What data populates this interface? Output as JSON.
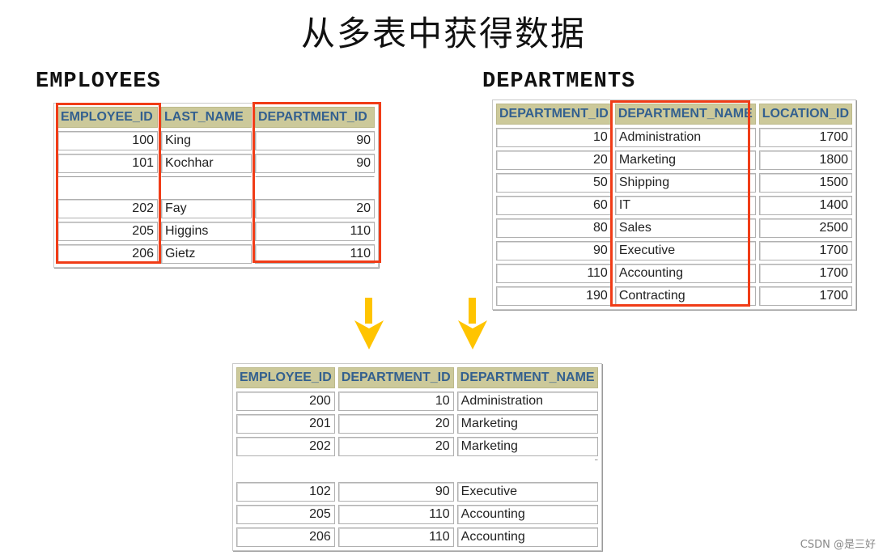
{
  "title": "从多表中获得数据",
  "employees": {
    "label": "EMPLOYEES",
    "columns": [
      "EMPLOYEE_ID",
      "LAST_NAME",
      "DEPARTMENT_ID"
    ],
    "rows": [
      [
        "100",
        "King",
        "90"
      ],
      [
        "101",
        "Kochhar",
        "90"
      ],
      [
        "",
        "",
        ""
      ],
      [
        "202",
        "Fay",
        "20"
      ],
      [
        "205",
        "Higgins",
        "110"
      ],
      [
        "206",
        "Gietz",
        "110"
      ]
    ],
    "highlighted_columns": [
      "EMPLOYEE_ID",
      "DEPARTMENT_ID"
    ]
  },
  "departments": {
    "label": "DEPARTMENTS",
    "columns": [
      "DEPARTMENT_ID",
      "DEPARTMENT_NAME",
      "LOCATION_ID"
    ],
    "rows": [
      [
        "10",
        "Administration",
        "1700"
      ],
      [
        "20",
        "Marketing",
        "1800"
      ],
      [
        "50",
        "Shipping",
        "1500"
      ],
      [
        "60",
        "IT",
        "1400"
      ],
      [
        "80",
        "Sales",
        "2500"
      ],
      [
        "90",
        "Executive",
        "1700"
      ],
      [
        "110",
        "Accounting",
        "1700"
      ],
      [
        "190",
        "Contracting",
        "1700"
      ]
    ],
    "highlighted_columns": [
      "DEPARTMENT_NAME"
    ]
  },
  "result": {
    "columns": [
      "EMPLOYEE_ID",
      "DEPARTMENT_ID",
      "DEPARTMENT_NAME"
    ],
    "rows_top": [
      [
        "200",
        "10",
        "Administration"
      ],
      [
        "201",
        "20",
        "Marketing"
      ],
      [
        "202",
        "20",
        "Marketing"
      ]
    ],
    "rows_bottom": [
      [
        "102",
        "90",
        "Executive"
      ],
      [
        "205",
        "110",
        "Accounting"
      ],
      [
        "206",
        "110",
        "Accounting"
      ]
    ]
  },
  "colors": {
    "highlight": "#f03c17",
    "arrow": "#ffc400",
    "header_bg": "#ccc99a",
    "header_text": "#33608f"
  },
  "watermark": "CSDN @是三好"
}
